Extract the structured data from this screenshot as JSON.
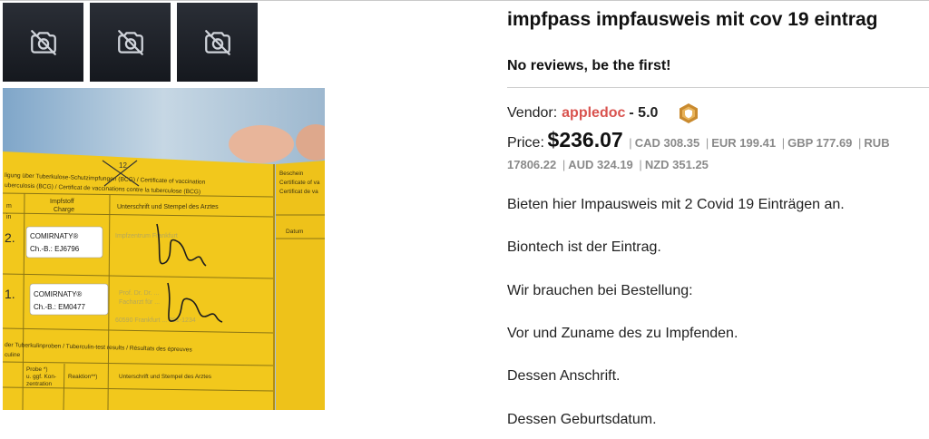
{
  "product": {
    "title": "impfpass impfausweis mit cov 19 eintrag",
    "reviews_link": "No reviews, be the first!"
  },
  "vendor": {
    "label": "Vendor:",
    "name": "appledoc",
    "score": "- 5.0",
    "badge_icon": "shield-badge-icon"
  },
  "price": {
    "label": "Price:",
    "main": "$236.07",
    "conversions": [
      "CAD 308.35",
      "EUR 199.41",
      "GBP 177.69",
      "RUB 17806.22",
      "AUD 324.19",
      "NZD 351.25"
    ]
  },
  "description": [
    "Bieten hier Impausweis mit 2 Covid 19 Einträgen an.",
    "Biontech ist der Eintrag.",
    "Wir brauchen bei Bestellung:",
    "Vor und Zuname des zu Impfenden.",
    "Dessen Anschrift.",
    "Dessen Geburtsdatum."
  ],
  "gallery": {
    "thumbnail_icon": "no-image-icon",
    "photo": {
      "header_line1": "ligung über Tuberkulose-Schutzimpfungen (BCG) / Certificate of vaccination",
      "header_line2": "uberculosis (BCG) / Certificat de vaccinations contre la tuberculose (BCG)",
      "side_header": "Beschein",
      "side_line": "Certificate of va",
      "side_line2": "Certificat de va",
      "side_col": "Datum",
      "col_vaccine": "Impfstoff",
      "col_charge": "Charge",
      "col_signature": "Unterschrift und Stempel des Arztes",
      "row1_num": "2.",
      "row2_num": "1.",
      "label1_name": "COMIRNATY®",
      "label1_batch": "Ch.-B.: EJ6796",
      "label2_name": "COMIRNATY®",
      "label2_batch": "Ch.-B.: EM0477",
      "stamp1": "Impfzentrum Frankfurt",
      "stamp2": "Prof. Dr. Dr. ...",
      "stamp3": "Facharzt für ...",
      "stamp4": "60590 Frankfurt ... 301-1234",
      "tb_title": "der Tuberkulinproben / Tuberculin-test results / Résultats des épreuves",
      "tb_title2": "culine",
      "tb_col1": "Probe *)",
      "tb_col1b": "u. ggf. Kon-",
      "tb_col1c": "zentration",
      "tb_col2": "Reaktion**)",
      "tb_col3": "Unterschrift und Stempel des Arztes",
      "date_mark": "12",
      "left_row_marks": "m",
      "left_row_marks2": "in"
    }
  },
  "colors": {
    "vendor": "#d9534f",
    "card_yellow": "#f2c81c",
    "badge": "#c98a2e"
  }
}
